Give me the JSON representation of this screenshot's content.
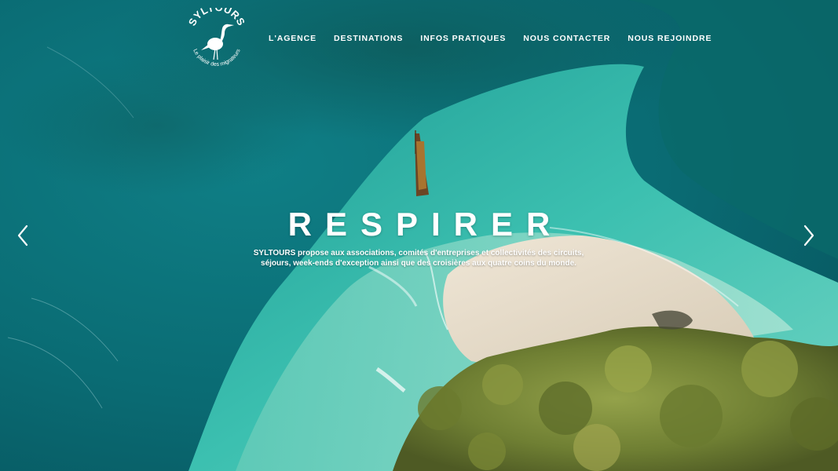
{
  "logo": {
    "brand": "SYLTOURS",
    "slogan": "Le plaisir des migrateurs"
  },
  "nav": {
    "items": [
      {
        "label": "L'AGENCE"
      },
      {
        "label": "DESTINATIONS"
      },
      {
        "label": "INFOS PRATIQUES"
      },
      {
        "label": "NOUS CONTACTER"
      },
      {
        "label": "NOUS REJOINDRE"
      }
    ]
  },
  "slider": {
    "headline": "RESPIRER",
    "tagline_line1": "SYLTOURS propose aux associations, comités d'entreprises et collectivités des circuits,",
    "tagline_line2": "séjours, week-ends d'exception ainsi que des croisières aux quatre coins du monde.",
    "prev_icon": "chevron-left-icon",
    "next_icon": "chevron-right-icon"
  },
  "colors": {
    "deep_sea": "#0a5e69",
    "lagoon": "#3fbfb0",
    "sand": "#e6dccb",
    "foliage": "#7a8a3a",
    "text": "#ffffff"
  }
}
